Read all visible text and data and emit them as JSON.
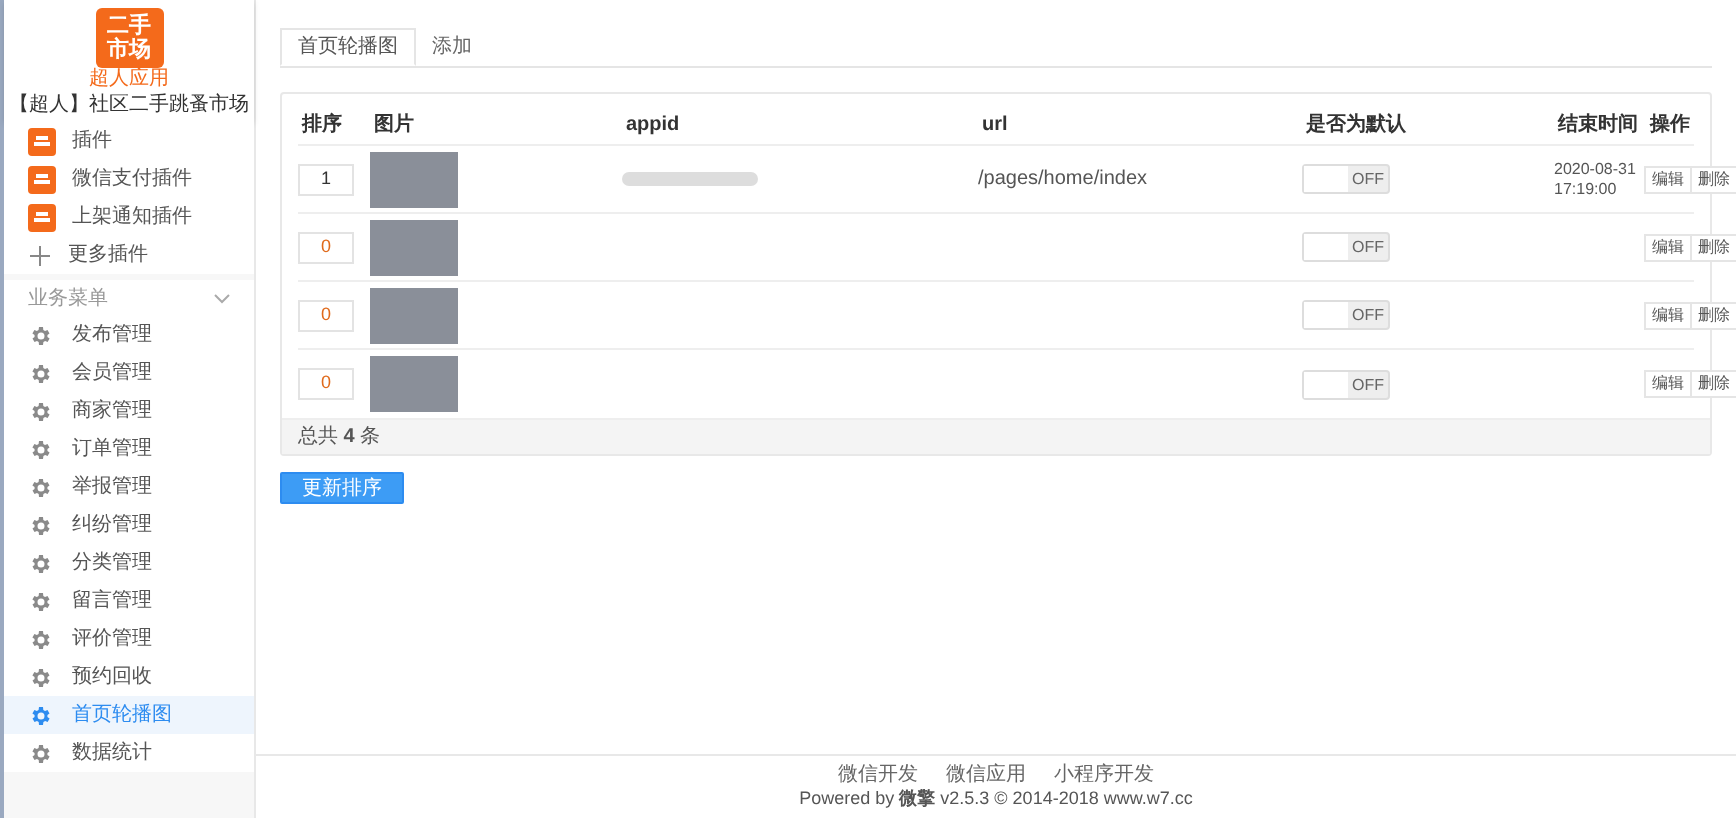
{
  "sidebar": {
    "logo_lines": [
      "二手",
      "市场"
    ],
    "logo_caption": "超人应用",
    "app_name": "【超人】社区二手跳蚤市场",
    "plugins": [
      {
        "kind": "app",
        "label": "插件"
      },
      {
        "kind": "app",
        "label": "微信支付插件"
      },
      {
        "kind": "app",
        "label": "上架通知插件"
      },
      {
        "kind": "more",
        "label": "更多插件"
      }
    ],
    "section": {
      "title": "业务菜单",
      "expanded": true
    },
    "items": [
      {
        "label": "发布管理",
        "selected": false
      },
      {
        "label": "会员管理",
        "selected": false
      },
      {
        "label": "商家管理",
        "selected": false
      },
      {
        "label": "订单管理",
        "selected": false
      },
      {
        "label": "举报管理",
        "selected": false
      },
      {
        "label": "纠纷管理",
        "selected": false
      },
      {
        "label": "分类管理",
        "selected": false
      },
      {
        "label": "留言管理",
        "selected": false
      },
      {
        "label": "评价管理",
        "selected": false
      },
      {
        "label": "预约回收",
        "selected": false
      },
      {
        "label": "首页轮播图",
        "selected": true
      },
      {
        "label": "数据统计",
        "selected": false
      }
    ]
  },
  "tabs": [
    {
      "label": "首页轮播图",
      "selected": true
    },
    {
      "label": "添加",
      "selected": false
    }
  ],
  "table": {
    "columns": [
      "排序",
      "图片",
      "appid",
      "url",
      "是否为默认",
      "结束时间",
      "操作"
    ],
    "rows": [
      {
        "order": "1",
        "appid_blurred": true,
        "url": "/pages/home/index",
        "default": false,
        "toggle_label": "OFF",
        "end_time": [
          "2020-08-31",
          "17:19:00"
        ],
        "actions": [
          "编辑",
          "删除"
        ]
      },
      {
        "order": "0",
        "appid_blurred": false,
        "default": false,
        "toggle_label": "OFF",
        "actions": [
          "编辑",
          "删除"
        ]
      },
      {
        "order": "0",
        "appid_blurred": false,
        "default": false,
        "toggle_label": "OFF",
        "actions": [
          "编辑",
          "删除"
        ]
      },
      {
        "order": "0",
        "appid_blurred": false,
        "default": false,
        "toggle_label": "OFF",
        "actions": [
          "编辑",
          "删除"
        ]
      }
    ],
    "total": "总共 **4** 条"
  },
  "update_button": "更新排序",
  "footer": {
    "links": [
      "微信开发",
      "微信应用",
      "小程序开发"
    ],
    "powered": "Powered by **微擎** v2.5.3 © 2014-2018 www.w7.cc"
  }
}
